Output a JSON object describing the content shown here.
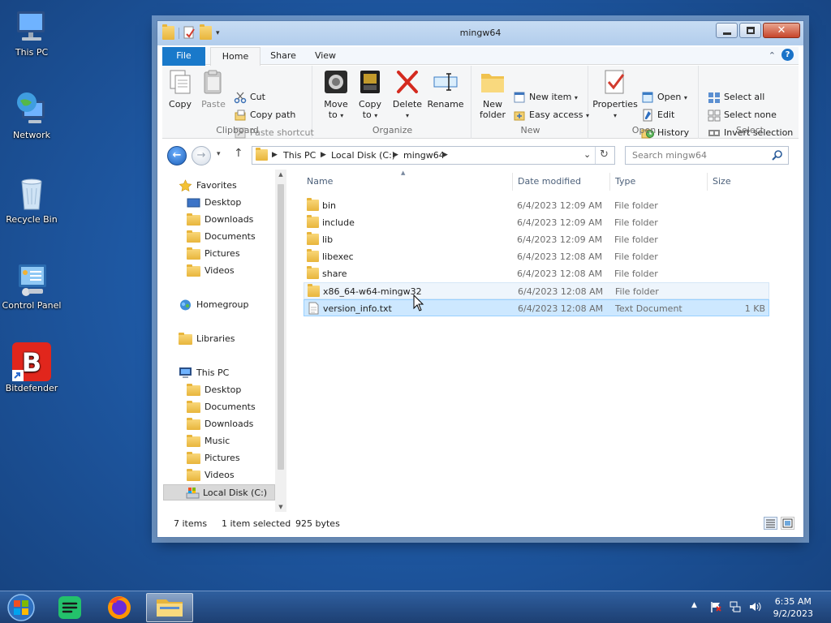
{
  "desktop": {
    "icons": [
      {
        "label": "This PC",
        "icon": "computer-icon"
      },
      {
        "label": "Network",
        "icon": "network-globe-icon"
      },
      {
        "label": "Recycle Bin",
        "icon": "recycle-bin-icon"
      },
      {
        "label": "Control Panel",
        "icon": "control-panel-icon"
      },
      {
        "label": "Bitdefender",
        "icon": "bitdefender-icon"
      }
    ]
  },
  "window": {
    "title": "mingw64",
    "tabs": [
      "File",
      "Home",
      "Share",
      "View"
    ],
    "active_tab": "Home",
    "accent": "#1979ca"
  },
  "ribbon": {
    "clipboard": {
      "label": "Clipboard",
      "copy": "Copy",
      "paste": "Paste",
      "cut": "Cut",
      "copy_path": "Copy path",
      "paste_shortcut": "Paste shortcut"
    },
    "organize": {
      "label": "Organize",
      "move_to_1": "Move",
      "move_to_2": "to",
      "copy_to_1": "Copy",
      "copy_to_2": "to",
      "delete": "Delete",
      "rename": "Rename"
    },
    "new": {
      "label": "New",
      "new_folder_1": "New",
      "new_folder_2": "folder",
      "new_item": "New item",
      "easy_access": "Easy access"
    },
    "open": {
      "label": "Open",
      "properties": "Properties",
      "open": "Open",
      "edit": "Edit",
      "history": "History"
    },
    "select": {
      "label": "Select",
      "select_all": "Select all",
      "select_none": "Select none",
      "invert_selection": "Invert selection"
    }
  },
  "address": {
    "segments": [
      "This PC",
      "Local Disk (C:)",
      "mingw64"
    ],
    "search_placeholder": "Search mingw64"
  },
  "navpane": {
    "favorites": {
      "label": "Favorites",
      "items": [
        "Desktop",
        "Downloads",
        "Documents",
        "Pictures",
        "Videos"
      ]
    },
    "homegroup": "Homegroup",
    "libraries": "Libraries",
    "thispc": {
      "label": "This PC",
      "items": [
        "Desktop",
        "Documents",
        "Downloads",
        "Music",
        "Pictures",
        "Videos",
        "Local Disk (C:)"
      ]
    }
  },
  "list": {
    "columns": [
      "Name",
      "Date modified",
      "Type",
      "Size"
    ],
    "rows": [
      {
        "name": "bin",
        "date": "6/4/2023 12:09 AM",
        "type": "File folder",
        "size": "",
        "kind": "folder"
      },
      {
        "name": "include",
        "date": "6/4/2023 12:09 AM",
        "type": "File folder",
        "size": "",
        "kind": "folder"
      },
      {
        "name": "lib",
        "date": "6/4/2023 12:09 AM",
        "type": "File folder",
        "size": "",
        "kind": "folder"
      },
      {
        "name": "libexec",
        "date": "6/4/2023 12:08 AM",
        "type": "File folder",
        "size": "",
        "kind": "folder"
      },
      {
        "name": "share",
        "date": "6/4/2023 12:08 AM",
        "type": "File folder",
        "size": "",
        "kind": "folder"
      },
      {
        "name": "x86_64-w64-mingw32",
        "date": "6/4/2023 12:08 AM",
        "type": "File folder",
        "size": "",
        "kind": "folder"
      },
      {
        "name": "version_info.txt",
        "date": "6/4/2023 12:08 AM",
        "type": "Text Document",
        "size": "1 KB",
        "kind": "text"
      }
    ],
    "selected_row": "version_info.txt"
  },
  "status": {
    "items": "7 items",
    "selection": "1 item selected",
    "bytes": "925 bytes"
  },
  "taskbar": {
    "time": "6:35 AM",
    "date": "9/2/2023"
  }
}
